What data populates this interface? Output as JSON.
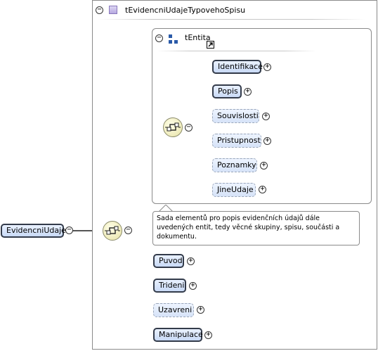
{
  "root": {
    "label": "EvidencniUdaje"
  },
  "type_box": {
    "title": "tEvidencniUdajeTypovehoSpisu"
  },
  "inner_box": {
    "title": "tEntita",
    "items": [
      {
        "label": "Identifikace"
      },
      {
        "label": "Popis"
      },
      {
        "label": "Souvislosti"
      },
      {
        "label": "Pristupnost"
      },
      {
        "label": "Poznamky"
      },
      {
        "label": "JineUdaje"
      }
    ],
    "description": "Sada elementů pro popis evidenčních údajů dále uvedených entit, tedy věcné skupiny, spisu, součásti a dokumentu."
  },
  "outer_items": [
    {
      "label": "Puvod"
    },
    {
      "label": "Trideni"
    },
    {
      "label": "Uzavreni"
    },
    {
      "label": "Manipulace"
    }
  ],
  "colors": {
    "element_fill": "#c9daf6",
    "connector": "#555555",
    "sequence_fill": "#e7e2a6"
  }
}
